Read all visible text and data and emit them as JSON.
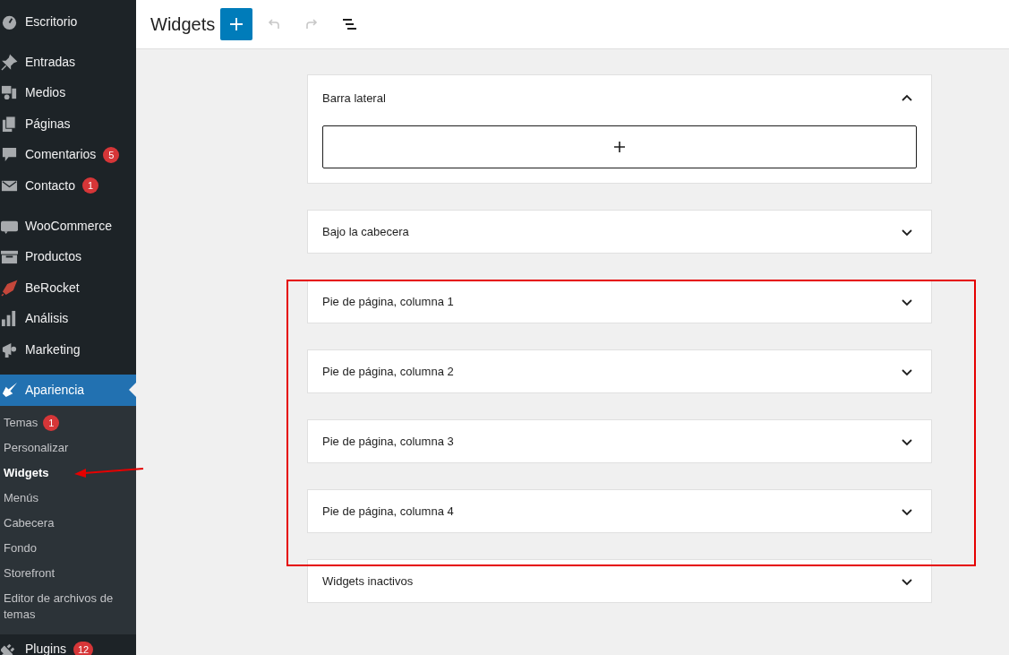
{
  "sidebar": {
    "groups": [
      [
        {
          "label": "Escritorio",
          "selected": false
        }
      ],
      [
        {
          "label": "Entradas",
          "selected": false
        },
        {
          "label": "Medios",
          "selected": false
        },
        {
          "label": "Páginas",
          "selected": false
        },
        {
          "label": "Comentarios",
          "badge": "5",
          "selected": false
        },
        {
          "label": "Contacto",
          "badge": "1",
          "selected": false
        }
      ],
      [
        {
          "label": "WooCommerce",
          "selected": false
        },
        {
          "label": "Productos",
          "selected": false
        },
        {
          "label": "BeRocket",
          "selected": false
        },
        {
          "label": "Análisis",
          "selected": false
        },
        {
          "label": "Marketing",
          "selected": false
        }
      ],
      [
        {
          "label": "Apariencia",
          "selected": true,
          "submenu": [
            {
              "label": "Temas",
              "badge": "1",
              "selected": false
            },
            {
              "label": "Personalizar",
              "selected": false
            },
            {
              "label": "Widgets",
              "selected": true
            },
            {
              "label": "Menús",
              "selected": false
            },
            {
              "label": "Cabecera",
              "selected": false
            },
            {
              "label": "Fondo",
              "selected": false
            },
            {
              "label": "Storefront",
              "selected": false
            },
            {
              "label": "Editor de archivos de temas",
              "selected": false
            }
          ]
        },
        {
          "label": "Plugins",
          "badge": "12",
          "selected": false
        }
      ]
    ]
  },
  "header": {
    "title": "Widgets",
    "toolbar": [
      {
        "kind": "add",
        "disabled": false
      },
      {
        "kind": "undo",
        "disabled": true
      },
      {
        "kind": "redo",
        "disabled": true
      },
      {
        "kind": "list-view",
        "disabled": false
      }
    ]
  },
  "widget_areas": [
    {
      "title": "Barra lateral",
      "expanded": true
    },
    {
      "title": "Bajo la cabecera",
      "expanded": false
    },
    {
      "title": "Pie de página, columna 1",
      "expanded": false
    },
    {
      "title": "Pie de página, columna 2",
      "expanded": false
    },
    {
      "title": "Pie de página, columna 3",
      "expanded": false
    },
    {
      "title": "Pie de página, columna 4",
      "expanded": false
    },
    {
      "title": "Widgets inactivos",
      "expanded": false
    }
  ]
}
